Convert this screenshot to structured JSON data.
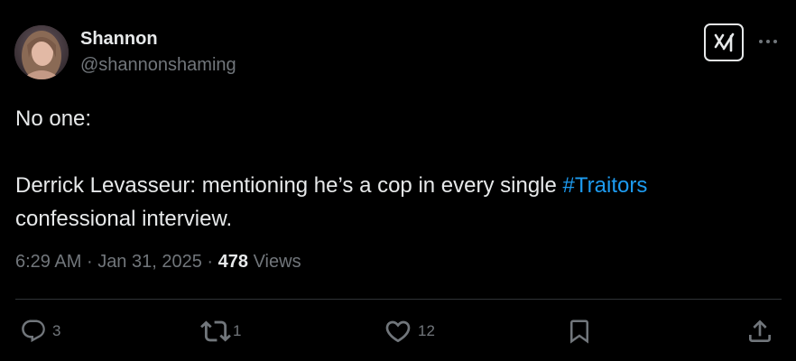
{
  "author": {
    "name": "Shannon",
    "handle": "@shannonshaming"
  },
  "post": {
    "line1": "No one:",
    "line2_prefix": "Derrick Levasseur: mentioning he’s a cop in every single ",
    "hashtag": "#Traitors",
    "line3": "confessional interview."
  },
  "meta": {
    "time": "6:29 AM",
    "separator": "·",
    "date": "Jan 31, 2025",
    "views_count": "478",
    "views_label": "Views"
  },
  "actions": {
    "replies": "3",
    "reposts": "1",
    "likes": "12"
  },
  "colors": {
    "background": "#000000",
    "text": "#e7e9ea",
    "muted": "#71767b",
    "link": "#1d9bf0",
    "divider": "#2f3336"
  },
  "icons": {
    "grok": "grok-icon",
    "more": "more-icon",
    "reply": "reply-icon",
    "repost": "repost-icon",
    "like": "heart-icon",
    "bookmark": "bookmark-icon",
    "share": "share-icon"
  }
}
